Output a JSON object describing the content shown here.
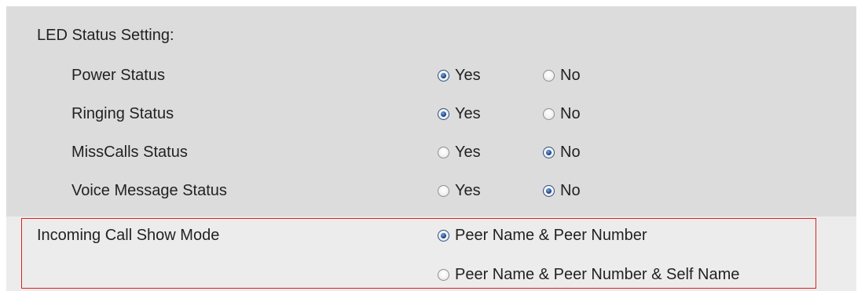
{
  "led_section": {
    "title": "LED Status Setting:",
    "rows": [
      {
        "label": "Power Status",
        "yes": "Yes",
        "no": "No",
        "selected": "yes"
      },
      {
        "label": "Ringing Status",
        "yes": "Yes",
        "no": "No",
        "selected": "yes"
      },
      {
        "label": "MissCalls Status",
        "yes": "Yes",
        "no": "No",
        "selected": "no"
      },
      {
        "label": "Voice Message Status",
        "yes": "Yes",
        "no": "No",
        "selected": "no"
      }
    ]
  },
  "incoming_call": {
    "label": "Incoming Call Show Mode",
    "options": [
      {
        "label": "Peer Name & Peer Number",
        "selected": true
      },
      {
        "label": "Peer Name & Peer Number & Self Name",
        "selected": false
      }
    ]
  },
  "colors": {
    "led_panel_bg": "#dcdcdc",
    "incoming_panel_bg": "#ececec",
    "highlight_border": "#e02020",
    "radio_selected": "#1f4f9c"
  }
}
